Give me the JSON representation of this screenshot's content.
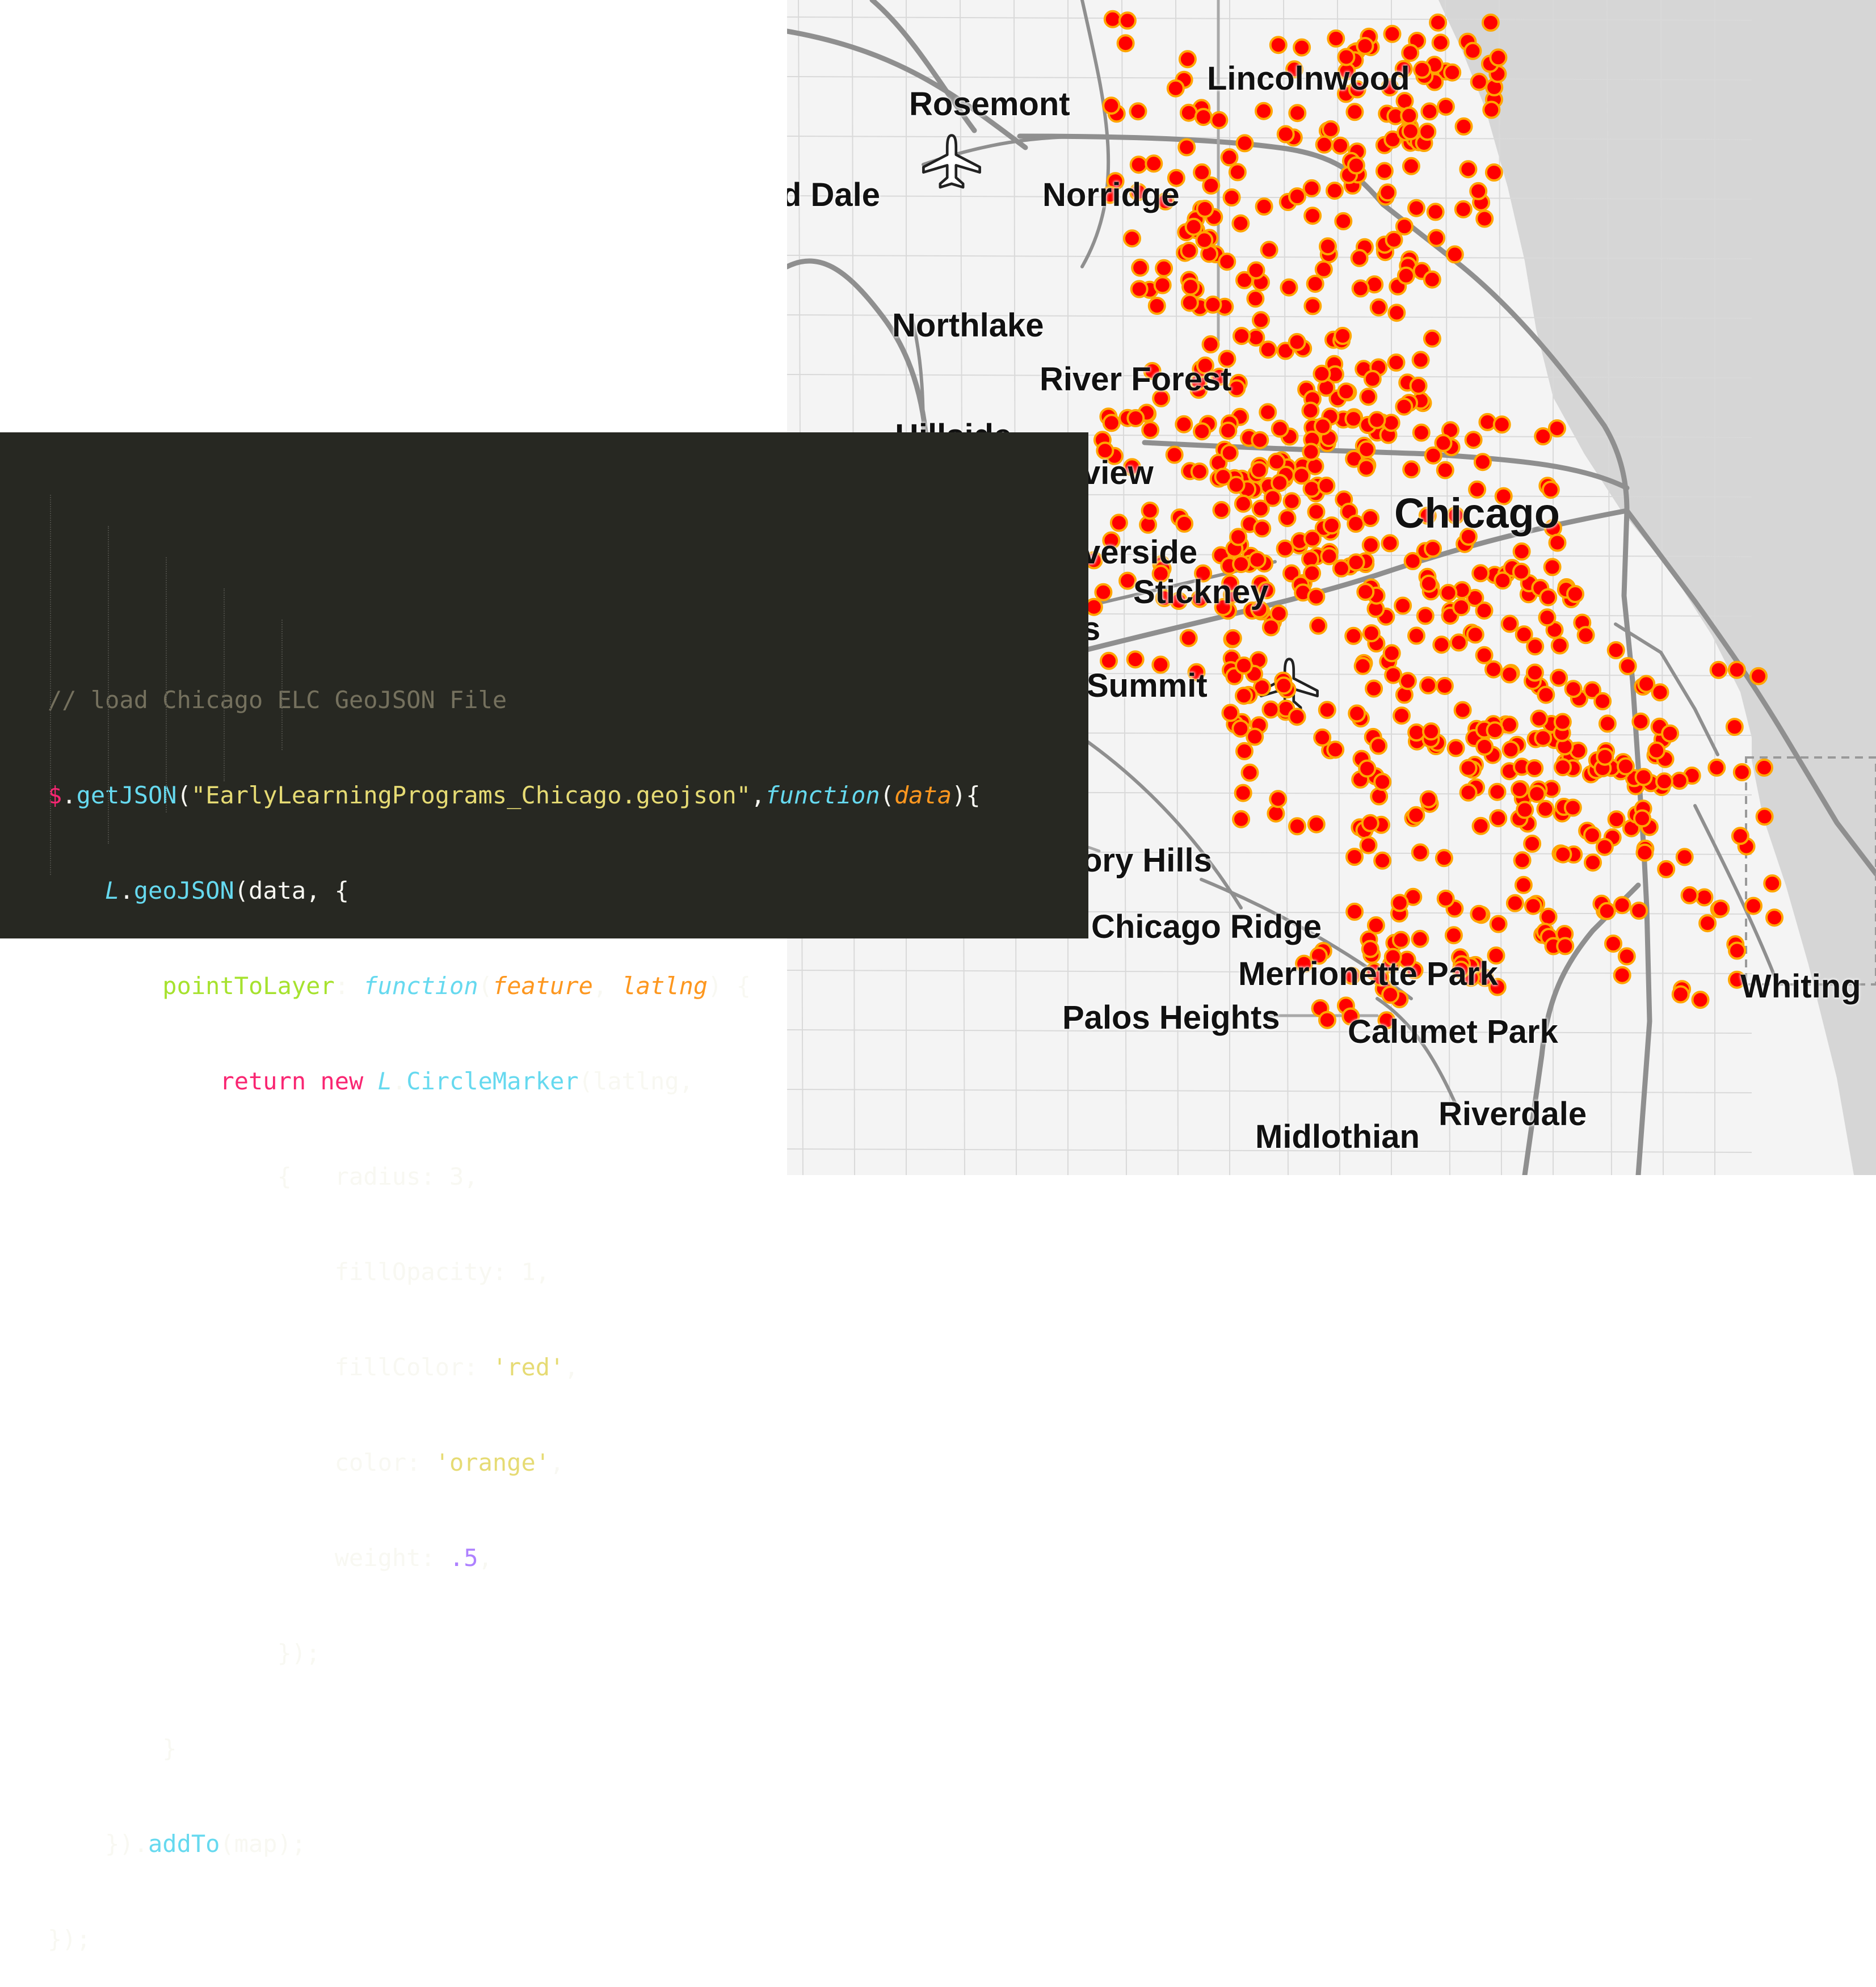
{
  "colors": {
    "code_background": "#272822",
    "map_background": "#f4f4f4",
    "water": "#d6d6d6",
    "marker_fill": "red",
    "marker_stroke": "orange"
  },
  "code": {
    "lines": [
      "// load Chicago ELC GeoJSON File",
      "$.getJSON(\"EarlyLearningPrograms_Chicago.geojson\",function(data){",
      "    L.geoJSON(data, {",
      "        pointToLayer: function(feature, latlng) {",
      "            return new L.CircleMarker(latlng,",
      "                {   radius: 3,",
      "                    fillOpacity: 1,",
      "                    fillColor: 'red',",
      "                    color: 'orange',",
      "                    weight: .5,",
      "                });",
      "        }",
      "    }).addTo(map);",
      "});"
    ]
  },
  "map": {
    "place_labels": [
      "Rosemont",
      "Lincolnwood",
      "d Dale",
      "Norridge",
      "Northlake",
      "River Forest",
      "Hillside",
      "view",
      "Chicago",
      "verside",
      "Stickney",
      "s",
      "Summit",
      "ory Hills",
      "Chicago Ridge",
      "Merrionette Park",
      "Palos Heights",
      "Calumet Park",
      "Whiting",
      "Midlothian",
      "Riverdale"
    ],
    "icons": [
      "airplane-icon",
      "airplane-icon"
    ],
    "marker_count": 600
  }
}
